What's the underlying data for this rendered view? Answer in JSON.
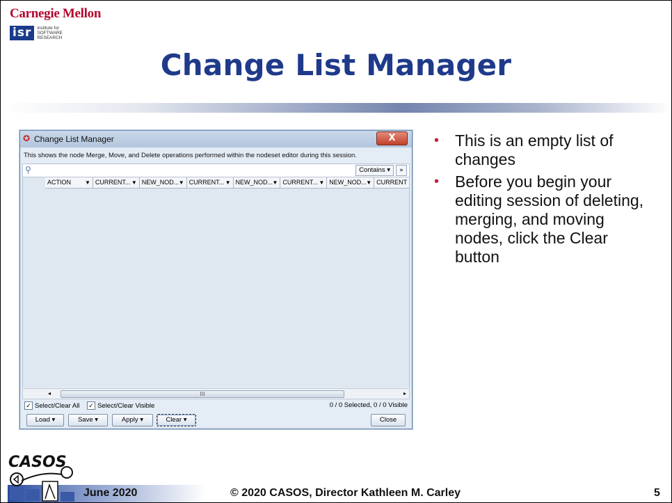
{
  "header": {
    "university": "Carnegie Mellon",
    "institute_abbr": "isr",
    "institute_lines": [
      "institute for",
      "SOFTWARE",
      "RESEARCH"
    ]
  },
  "slide": {
    "title": "Change List Manager",
    "bullets": [
      "This is an empty list of changes",
      "Before you begin your editing session of deleting, merging, and moving nodes, click the Clear button"
    ]
  },
  "window": {
    "title": "Change List Manager",
    "close_label": "X",
    "description": "This shows the node Merge, Move, and Delete operations performed within the nodeset editor during this session.",
    "filter_mode": "Contains",
    "columns": [
      "ACTION",
      "CURRENT...",
      "NEW_NOD...",
      "CURRENT...",
      "NEW_NOD...",
      "CURRENT...",
      "NEW_NOD...",
      "CURRENT"
    ],
    "scroll_grip": "III",
    "select_all_label": "Select/Clear All",
    "select_visible_label": "Select/Clear Visible",
    "selection_status": "0 / 0 Selected, 0 / 0 Visible",
    "buttons": {
      "load": "Load",
      "save": "Save",
      "apply": "Apply",
      "clear": "Clear",
      "close": "Close"
    }
  },
  "footer": {
    "logo_text": "CASOS",
    "date": "June 2020",
    "copyright": "© 2020 CASOS, Director Kathleen M. Carley",
    "page_number": "5"
  }
}
